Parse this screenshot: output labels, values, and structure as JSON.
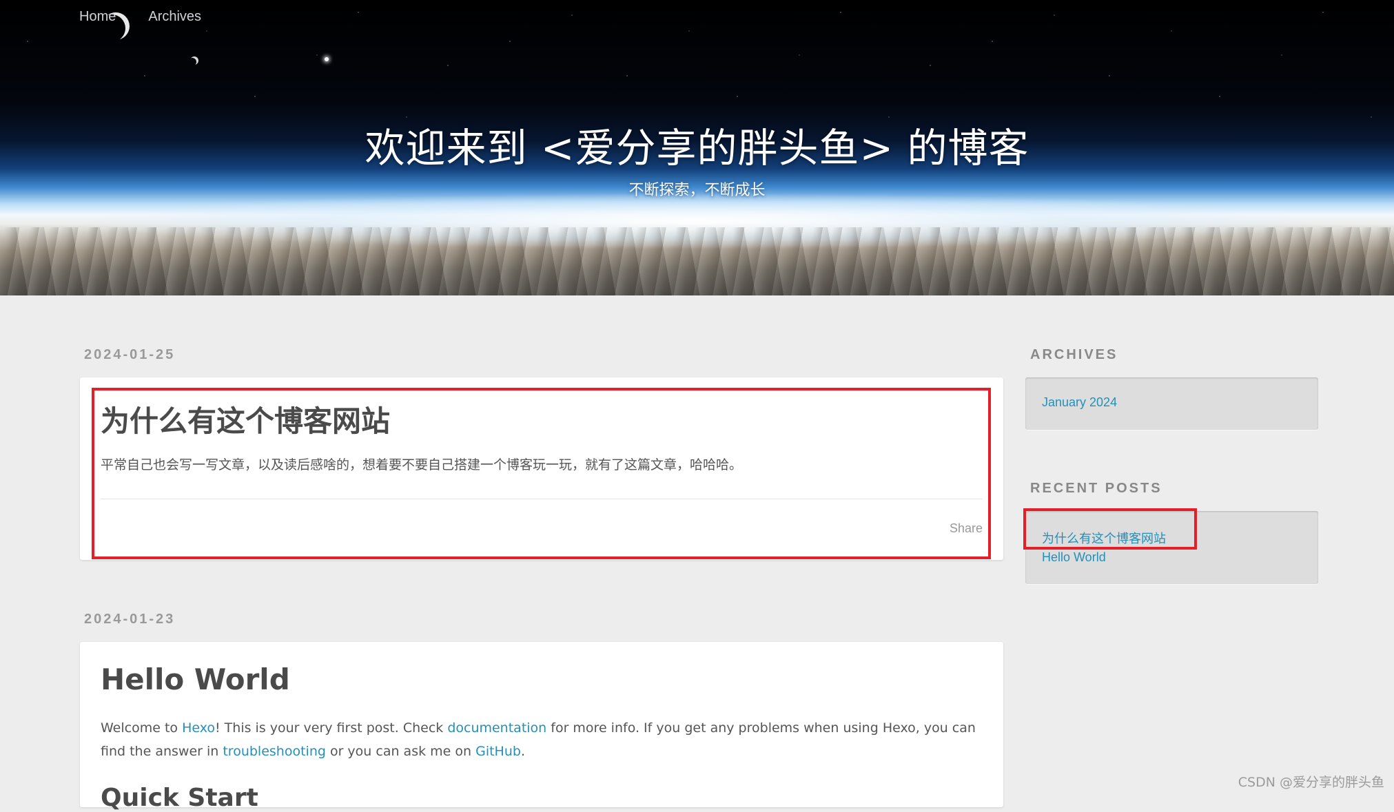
{
  "nav": {
    "items": [
      {
        "label": "Home"
      },
      {
        "label": "Archives"
      }
    ]
  },
  "banner": {
    "title": "欢迎来到 <爱分享的胖头鱼> 的博客",
    "subtitle": "不断探索，不断成长"
  },
  "posts": [
    {
      "date": "2024-01-25",
      "title": "为什么有这个博客网站",
      "excerpt": "平常自己也会写一写文章，以及读后感啥的，想着要不要自己搭建一个博客玩一玩，就有了这篇文章，哈哈哈。",
      "share_label": "Share"
    },
    {
      "date": "2024-01-23",
      "title": "Hello World",
      "body": {
        "t1": "Welcome to ",
        "link1": "Hexo",
        "t2": "! This is your very first post. Check ",
        "link2": "documentation",
        "t3": " for more info. If you get any problems when using Hexo, you can find the answer in ",
        "link3": "troubleshooting",
        "t4": " or you can ask me on ",
        "link4": "GitHub",
        "t5": "."
      },
      "next_heading": "Quick Start"
    }
  ],
  "sidebar": {
    "archives": {
      "title": "ARCHIVES",
      "items": [
        {
          "label": "January 2024"
        }
      ]
    },
    "recent_posts": {
      "title": "RECENT POSTS",
      "items": [
        {
          "label": "为什么有这个博客网站"
        },
        {
          "label": "Hello World"
        }
      ]
    }
  },
  "watermark": "CSDN @爱分享的胖头鱼",
  "colors": {
    "link": "#258fb8",
    "highlight": "#e3202a",
    "page_bg": "#ededed"
  }
}
